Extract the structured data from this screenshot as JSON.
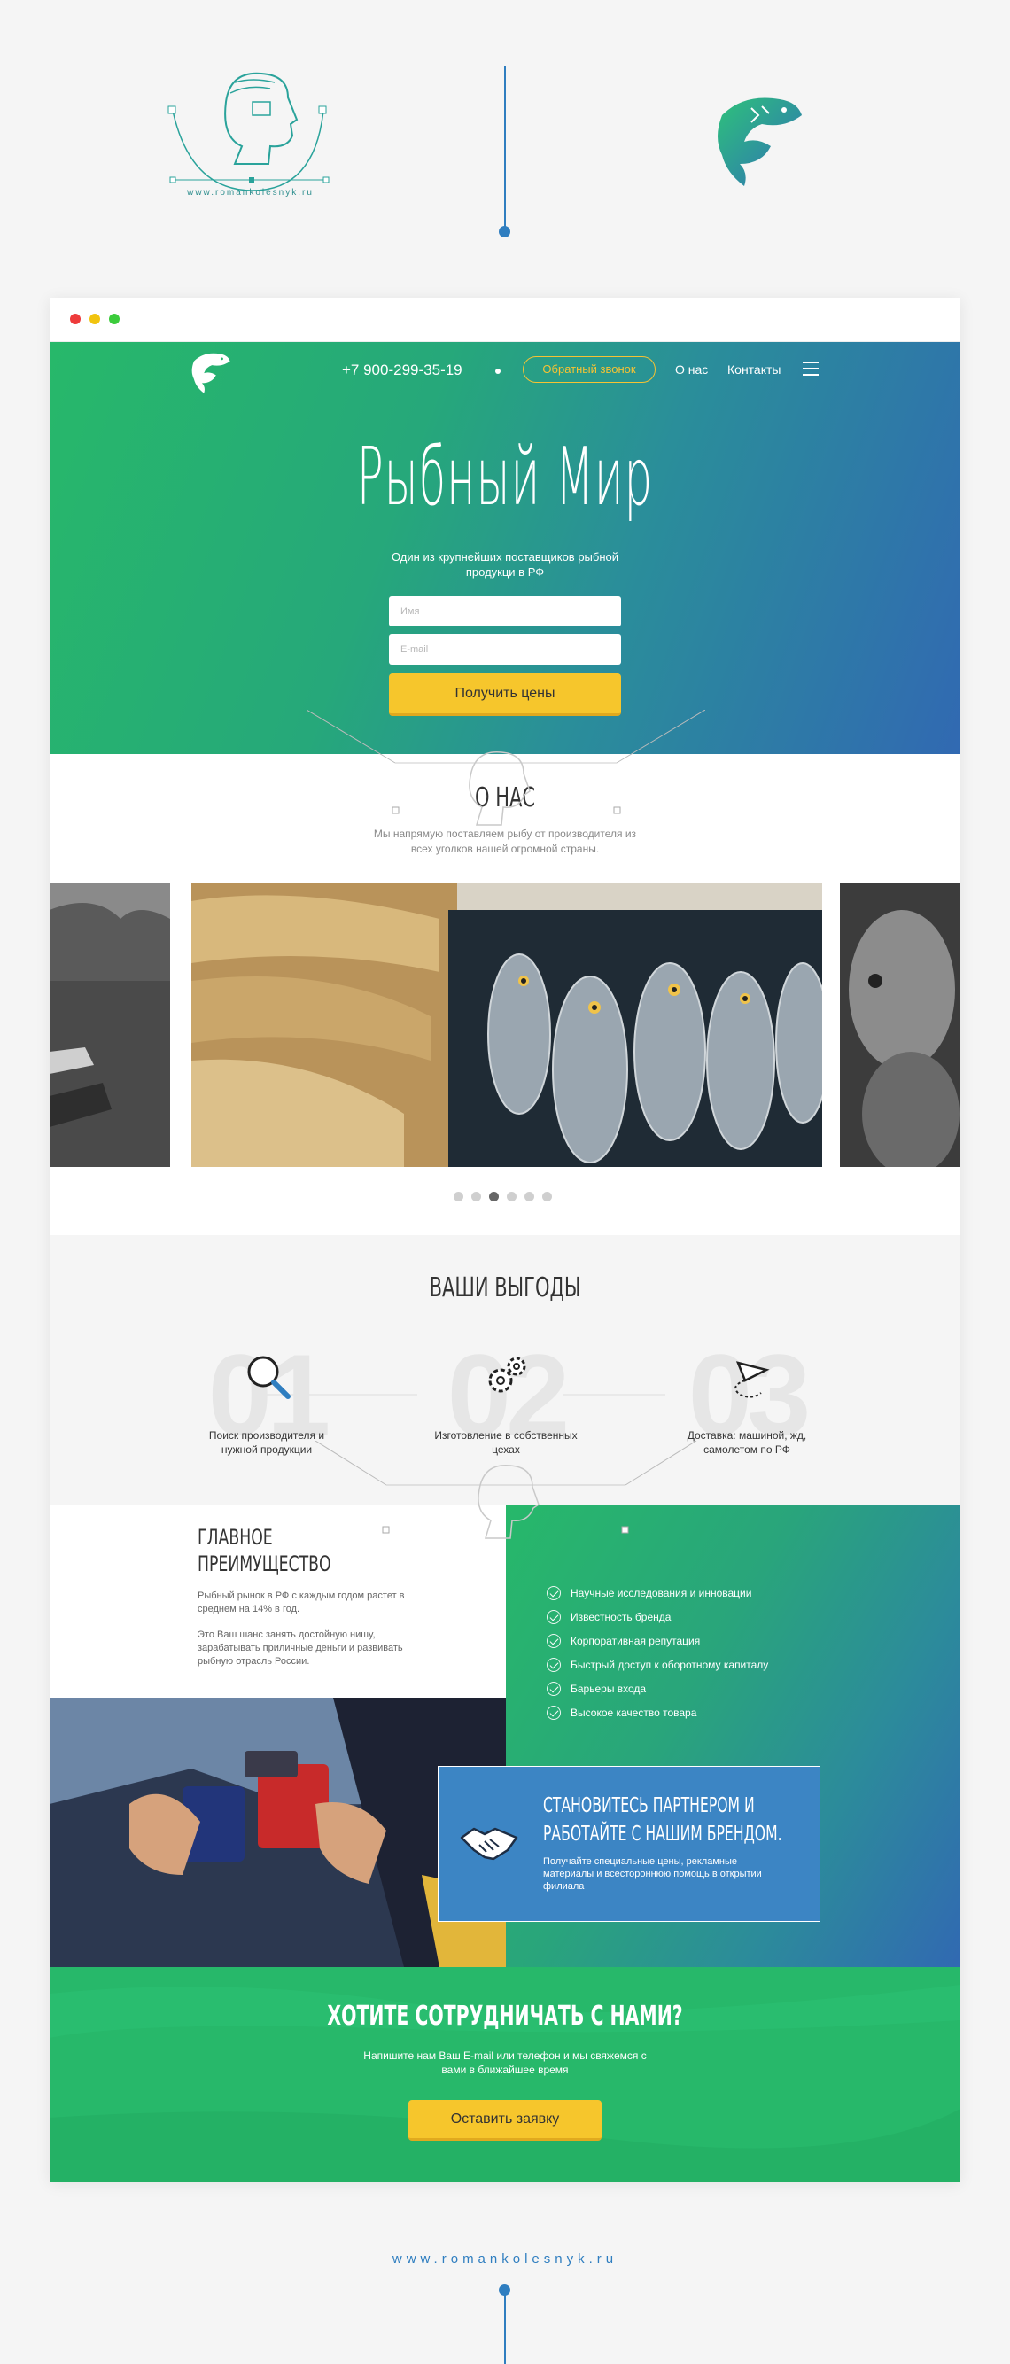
{
  "author": {
    "url": "www.romankolesnyk.ru"
  },
  "nav": {
    "phone": "+7 900-299-35-19",
    "callback": "Обратный звонок",
    "about": "О нас",
    "contacts": "Контакты"
  },
  "hero": {
    "title": "Рыбный Мир",
    "subtitle": "Один из крупнейших поставщиков рыбной продукци в РФ",
    "name_placeholder": "Имя",
    "email_placeholder": "E-mail",
    "button": "Получить цены"
  },
  "about": {
    "title": "О НАС",
    "text": "Мы напрямую поставляем рыбу от производителя из всех уголков нашей огромной страны.",
    "slider_dots": 6,
    "active_slide": 3
  },
  "benefits": {
    "title": "ВАШИ ВЫГОДЫ",
    "items": [
      {
        "number": "01",
        "label": "Поиск производителя и нужной продукции",
        "icon": "magnifier-icon"
      },
      {
        "number": "02",
        "label": "Изготовление в собственных цехах",
        "icon": "gears-icon"
      },
      {
        "number": "03",
        "label": "Доставка: машиной, жд, самолетом по РФ",
        "icon": "paper-plane-icon"
      }
    ]
  },
  "advantage": {
    "title_line1": "ГЛАВНОЕ",
    "title_line2": "ПРЕИМУЩЕСТВО",
    "p1": "Рыбный рынок в РФ с каждым годом растет в среднем на 14% в год.",
    "p2": "Это Ваш шанс занять достойную нишу, зарабатывать приличные деньги и развивать рыбную отрасль России.",
    "checklist": [
      "Научные исследования и инновации",
      "Известность бренда",
      "Корпоративная репутация",
      "Быстрый доступ к оборотному капиталу",
      "Барьеры входа",
      "Высокое качество товара"
    ]
  },
  "partner": {
    "title_line1": "СТАНОВИТЕСЬ ПАРТНЕРОМ И",
    "title_line2": "РАБОТАЙТЕ С НАШИМ БРЕНДОМ.",
    "text": "Получайте специальные цены, рекламные материалы и всестороннюю помощь в открытии филиала"
  },
  "cta": {
    "title": "ХОТИТЕ СОТРУДНИЧАТЬ С НАМИ?",
    "text": "Напишите нам Ваш E-mail или телефон и мы свяжемся с вами в ближайшее время",
    "button": "Оставить заявку"
  },
  "colors": {
    "green": "#27b86a",
    "blue": "#3169b2",
    "yellow": "#f6c62c",
    "accent_blue": "#2f7ec0"
  }
}
